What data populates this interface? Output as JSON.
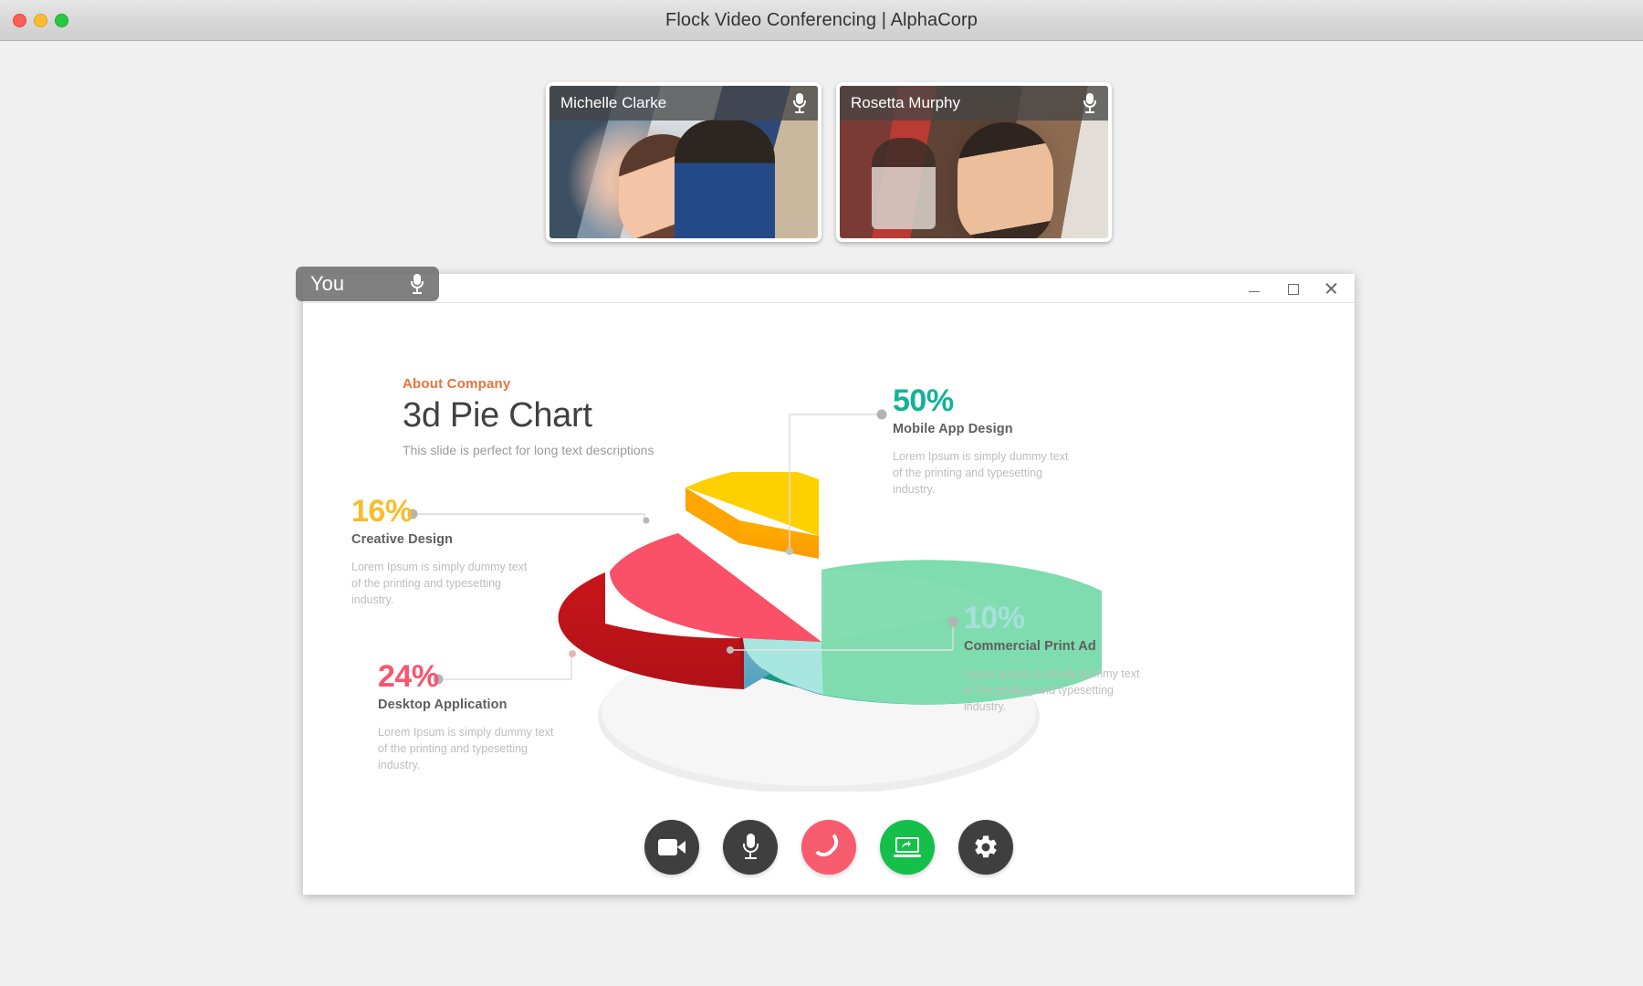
{
  "window": {
    "title": "Flock Video Conferencing | AlphaCorp",
    "traffic_lights": [
      "close",
      "minimize",
      "maximize"
    ]
  },
  "participants": [
    {
      "name": "Michelle Clarke",
      "mic": "mic-icon"
    },
    {
      "name": "Rosetta Murphy",
      "mic": "mic-icon"
    }
  ],
  "self_tile": {
    "name": "You",
    "mic": "mic-icon"
  },
  "share_window": {
    "controls": [
      "minimize",
      "maximize",
      "close"
    ]
  },
  "slide": {
    "eyebrow": "About Company",
    "title": "3d Pie Chart",
    "subtitle": "This slide is perfect for long text descriptions"
  },
  "chart_data": {
    "type": "pie",
    "title": "3d Pie Chart",
    "subtitle": "This slide is perfect for long text descriptions",
    "style": "3d-exploded-donutless",
    "legend_position": "callouts-around-chart",
    "grid": false,
    "categories": [
      "Mobile App Design",
      "Creative Design",
      "Desktop Application",
      "Commercial Print Ad"
    ],
    "values": [
      50,
      16,
      24,
      10
    ],
    "value_labels": [
      "50%",
      "16%",
      "24%",
      "10%"
    ],
    "colors": [
      "#7FDCAE",
      "#FFD000",
      "#FA5068",
      "#A8E6E0"
    ],
    "side_colors": [
      "#0FB295",
      "#FFA400",
      "#C51A1A",
      "#5BA8C4"
    ],
    "label_colors": [
      "#11b398",
      "#f9bd2b",
      "#f7566f",
      "#a8e0db"
    ],
    "exploded": [
      false,
      true,
      false,
      false
    ],
    "slices": [
      {
        "percent": "50%",
        "category": "Mobile App Design",
        "description": "Lorem Ipsum is simply dummy text of the printing and typesetting industry.",
        "color": "#11b398"
      },
      {
        "percent": "16%",
        "category": "Creative Design",
        "description": "Lorem Ipsum is simply dummy text of the printing and typesetting industry.",
        "color": "#f9bd2b"
      },
      {
        "percent": "24%",
        "category": "Desktop Application",
        "description": "Lorem Ipsum is simply dummy text of the printing and typesetting industry.",
        "color": "#f7566f"
      },
      {
        "percent": "10%",
        "category": "Commercial Print Ad",
        "description": "Lorem Ipsum is simply dummy text of the printing and typesetting industry.",
        "color": "#a8e0db"
      }
    ]
  },
  "call_controls": [
    {
      "name": "camera-button",
      "icon": "camera-icon",
      "color": "#3f3f3f"
    },
    {
      "name": "microphone-button",
      "icon": "microphone-icon",
      "color": "#3f3f3f"
    },
    {
      "name": "hang-up-button",
      "icon": "phone-hangup-icon",
      "color": "#f75c6e"
    },
    {
      "name": "screen-share-button",
      "icon": "screen-share-icon",
      "color": "#14c04a"
    },
    {
      "name": "settings-button",
      "icon": "gear-icon",
      "color": "#3f3f3f"
    }
  ],
  "colors": {
    "accent_orange": "#e8743b",
    "title_gray": "#414141",
    "muted_gray": "#9b9b9b",
    "hangup_red": "#f75c6e",
    "share_green": "#14c04a"
  }
}
